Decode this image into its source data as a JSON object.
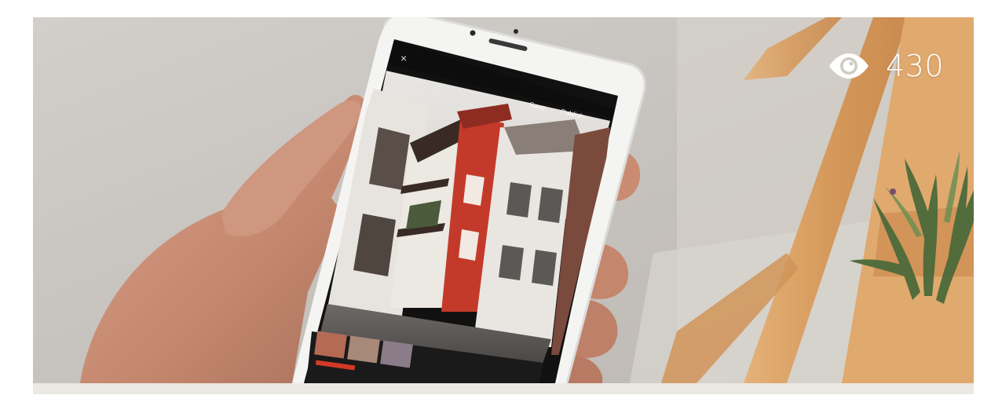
{
  "post": {
    "image_alt": "Hand holding a smartphone showing a photo of colorful old houses in a narrow alley",
    "views": {
      "icon": "eye-icon",
      "count": "430"
    }
  },
  "phone_screen": {
    "close_label": "×",
    "save_label": "Save",
    "publish_label": "Publish"
  },
  "colors": {
    "background": "#ffffff",
    "card_bg": "#cfcac4",
    "wall": "#c9c5c0",
    "wood": "#d9a36a",
    "leaf": "#4a6b3a",
    "skin": "#c98f76",
    "red_house": "#c43a2a"
  }
}
